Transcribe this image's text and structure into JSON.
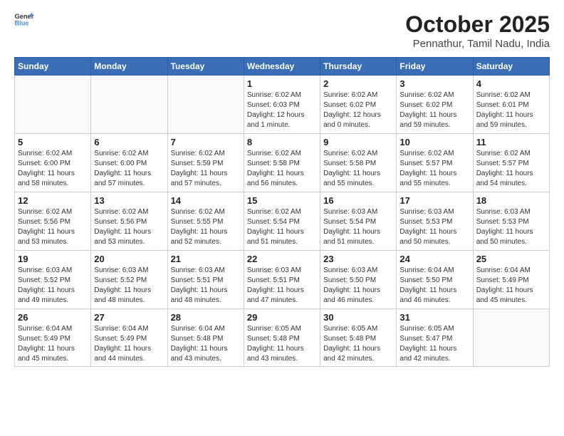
{
  "header": {
    "logo_general": "General",
    "logo_blue": "Blue",
    "month_title": "October 2025",
    "subtitle": "Pennathur, Tamil Nadu, India"
  },
  "calendar": {
    "weekdays": [
      "Sunday",
      "Monday",
      "Tuesday",
      "Wednesday",
      "Thursday",
      "Friday",
      "Saturday"
    ],
    "weeks": [
      [
        {
          "day": "",
          "info": ""
        },
        {
          "day": "",
          "info": ""
        },
        {
          "day": "",
          "info": ""
        },
        {
          "day": "1",
          "info": "Sunrise: 6:02 AM\nSunset: 6:03 PM\nDaylight: 12 hours\nand 1 minute."
        },
        {
          "day": "2",
          "info": "Sunrise: 6:02 AM\nSunset: 6:02 PM\nDaylight: 12 hours\nand 0 minutes."
        },
        {
          "day": "3",
          "info": "Sunrise: 6:02 AM\nSunset: 6:02 PM\nDaylight: 11 hours\nand 59 minutes."
        },
        {
          "day": "4",
          "info": "Sunrise: 6:02 AM\nSunset: 6:01 PM\nDaylight: 11 hours\nand 59 minutes."
        }
      ],
      [
        {
          "day": "5",
          "info": "Sunrise: 6:02 AM\nSunset: 6:00 PM\nDaylight: 11 hours\nand 58 minutes."
        },
        {
          "day": "6",
          "info": "Sunrise: 6:02 AM\nSunset: 6:00 PM\nDaylight: 11 hours\nand 57 minutes."
        },
        {
          "day": "7",
          "info": "Sunrise: 6:02 AM\nSunset: 5:59 PM\nDaylight: 11 hours\nand 57 minutes."
        },
        {
          "day": "8",
          "info": "Sunrise: 6:02 AM\nSunset: 5:58 PM\nDaylight: 11 hours\nand 56 minutes."
        },
        {
          "day": "9",
          "info": "Sunrise: 6:02 AM\nSunset: 5:58 PM\nDaylight: 11 hours\nand 55 minutes."
        },
        {
          "day": "10",
          "info": "Sunrise: 6:02 AM\nSunset: 5:57 PM\nDaylight: 11 hours\nand 55 minutes."
        },
        {
          "day": "11",
          "info": "Sunrise: 6:02 AM\nSunset: 5:57 PM\nDaylight: 11 hours\nand 54 minutes."
        }
      ],
      [
        {
          "day": "12",
          "info": "Sunrise: 6:02 AM\nSunset: 5:56 PM\nDaylight: 11 hours\nand 53 minutes."
        },
        {
          "day": "13",
          "info": "Sunrise: 6:02 AM\nSunset: 5:56 PM\nDaylight: 11 hours\nand 53 minutes."
        },
        {
          "day": "14",
          "info": "Sunrise: 6:02 AM\nSunset: 5:55 PM\nDaylight: 11 hours\nand 52 minutes."
        },
        {
          "day": "15",
          "info": "Sunrise: 6:02 AM\nSunset: 5:54 PM\nDaylight: 11 hours\nand 51 minutes."
        },
        {
          "day": "16",
          "info": "Sunrise: 6:03 AM\nSunset: 5:54 PM\nDaylight: 11 hours\nand 51 minutes."
        },
        {
          "day": "17",
          "info": "Sunrise: 6:03 AM\nSunset: 5:53 PM\nDaylight: 11 hours\nand 50 minutes."
        },
        {
          "day": "18",
          "info": "Sunrise: 6:03 AM\nSunset: 5:53 PM\nDaylight: 11 hours\nand 50 minutes."
        }
      ],
      [
        {
          "day": "19",
          "info": "Sunrise: 6:03 AM\nSunset: 5:52 PM\nDaylight: 11 hours\nand 49 minutes."
        },
        {
          "day": "20",
          "info": "Sunrise: 6:03 AM\nSunset: 5:52 PM\nDaylight: 11 hours\nand 48 minutes."
        },
        {
          "day": "21",
          "info": "Sunrise: 6:03 AM\nSunset: 5:51 PM\nDaylight: 11 hours\nand 48 minutes."
        },
        {
          "day": "22",
          "info": "Sunrise: 6:03 AM\nSunset: 5:51 PM\nDaylight: 11 hours\nand 47 minutes."
        },
        {
          "day": "23",
          "info": "Sunrise: 6:03 AM\nSunset: 5:50 PM\nDaylight: 11 hours\nand 46 minutes."
        },
        {
          "day": "24",
          "info": "Sunrise: 6:04 AM\nSunset: 5:50 PM\nDaylight: 11 hours\nand 46 minutes."
        },
        {
          "day": "25",
          "info": "Sunrise: 6:04 AM\nSunset: 5:49 PM\nDaylight: 11 hours\nand 45 minutes."
        }
      ],
      [
        {
          "day": "26",
          "info": "Sunrise: 6:04 AM\nSunset: 5:49 PM\nDaylight: 11 hours\nand 45 minutes."
        },
        {
          "day": "27",
          "info": "Sunrise: 6:04 AM\nSunset: 5:49 PM\nDaylight: 11 hours\nand 44 minutes."
        },
        {
          "day": "28",
          "info": "Sunrise: 6:04 AM\nSunset: 5:48 PM\nDaylight: 11 hours\nand 43 minutes."
        },
        {
          "day": "29",
          "info": "Sunrise: 6:05 AM\nSunset: 5:48 PM\nDaylight: 11 hours\nand 43 minutes."
        },
        {
          "day": "30",
          "info": "Sunrise: 6:05 AM\nSunset: 5:48 PM\nDaylight: 11 hours\nand 42 minutes."
        },
        {
          "day": "31",
          "info": "Sunrise: 6:05 AM\nSunset: 5:47 PM\nDaylight: 11 hours\nand 42 minutes."
        },
        {
          "day": "",
          "info": ""
        }
      ]
    ]
  }
}
